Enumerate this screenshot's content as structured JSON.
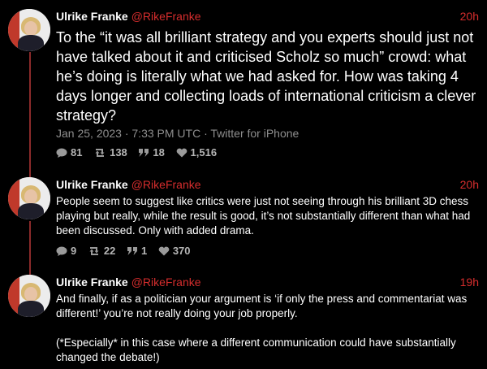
{
  "colors": {
    "background": "#000000",
    "accent": "#d62d2d",
    "muted": "#8e8e8e",
    "thread_line": "#8b2a2a"
  },
  "tweets": [
    {
      "author": "Ulrike Franke",
      "handle": "@RikeFranke",
      "time": "20h",
      "text": "To the “it was all brilliant strategy and you experts should just not have talked about it and criticised Scholz so much” crowd: what he’s doing is literally what we had asked for. How was taking 4 days longer and collecting loads of international criticism a clever strategy?",
      "meta": "Jan 25, 2023 · 7:33 PM UTC · Twitter for iPhone",
      "replies": "81",
      "retweets": "138",
      "quotes": "18",
      "likes": "1,516"
    },
    {
      "author": "Ulrike Franke",
      "handle": "@RikeFranke",
      "time": "20h",
      "text": "People seem to suggest like critics were just not seeing through his brilliant 3D chess playing but really, while the result is good, it’s not substantially different than what had been discussed. Only with added drama.",
      "replies": "9",
      "retweets": "22",
      "quotes": "1",
      "likes": "370"
    },
    {
      "author": "Ulrike Franke",
      "handle": "@RikeFranke",
      "time": "19h",
      "text_p1": "And finally, if as a politician your argument is ‘if only the press and commentariat was different!’ you’re not really doing your job properly.",
      "text_p2": "(*Especially* in this case where a different communication could have substantially changed the debate!)"
    }
  ]
}
